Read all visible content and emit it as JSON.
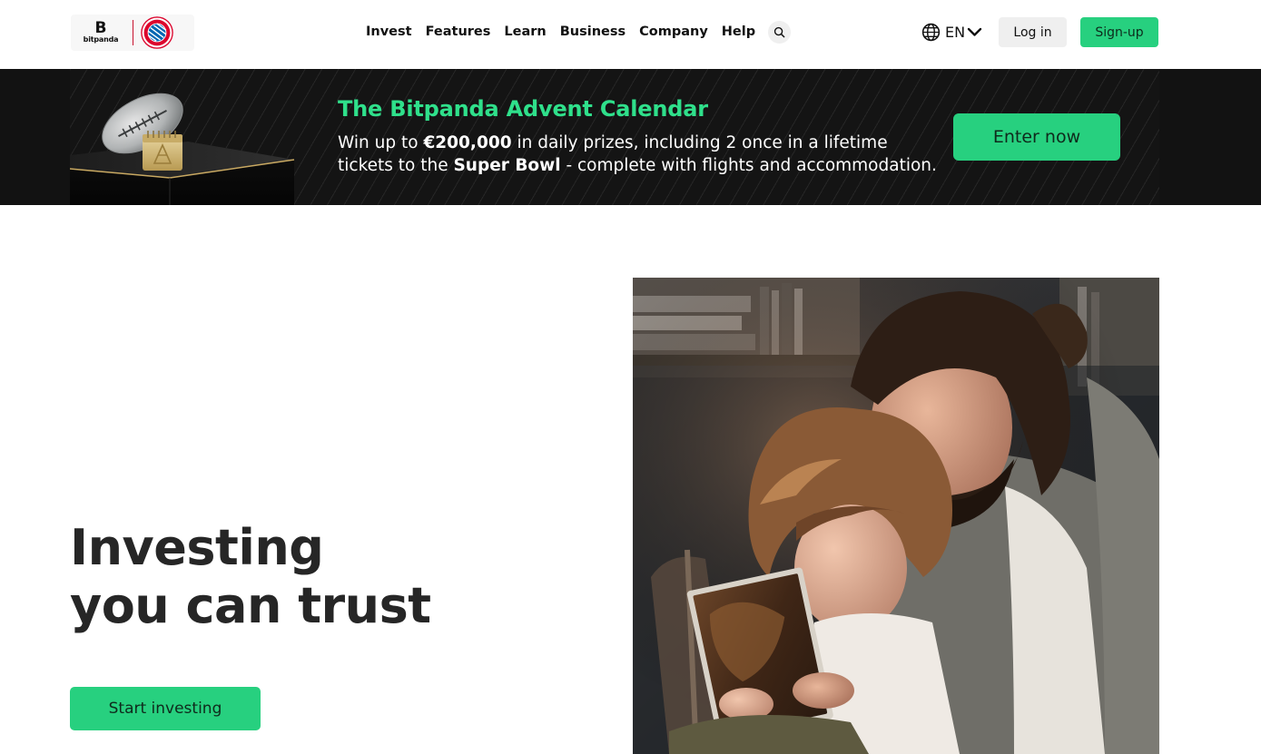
{
  "header": {
    "logo": {
      "brand": "bitpanda",
      "monogram": "B",
      "partner": "FC Bayern München"
    },
    "nav": [
      {
        "label": "Invest"
      },
      {
        "label": "Features"
      },
      {
        "label": "Learn"
      },
      {
        "label": "Business"
      },
      {
        "label": "Company"
      },
      {
        "label": "Help"
      }
    ],
    "search_icon": "search-icon",
    "language": {
      "icon": "globe-icon",
      "label": "EN",
      "chevron": "chevron-down-icon"
    },
    "login_label": "Log in",
    "signup_label": "Sign-up"
  },
  "banner": {
    "title": "The Bitpanda Advent Calendar",
    "text_parts": {
      "p1": "Win up to ",
      "amount": "€200,000",
      "p2": " in daily prizes, including 2 once in a lifetime tickets to the ",
      "event": "Super Bowl",
      "p3": " - complete with flights and accommodation."
    },
    "cta_label": "Enter now",
    "illustration": "football-calendar-illustration"
  },
  "hero": {
    "title_line1": "Investing",
    "title_line2": "you can trust",
    "cta_label": "Start investing",
    "image": "father-child-reading-photo"
  },
  "colors": {
    "accent": "#27d07f",
    "banner_title": "#2fe08b",
    "banner_bg": "#141414",
    "text": "#262626"
  }
}
